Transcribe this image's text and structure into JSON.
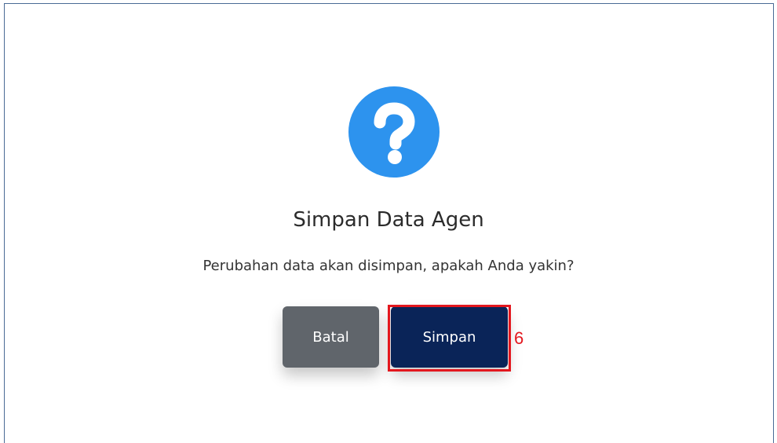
{
  "dialog": {
    "title": "Simpan Data Agen",
    "message": "Perubahan data akan disimpan, apakah Anda yakin?",
    "icon": "question-circle-icon",
    "cancel_label": "Batal",
    "confirm_label": "Simpan"
  },
  "annotation": {
    "step_number": "6"
  },
  "colors": {
    "icon_blue": "#2d93ee",
    "cancel_gray": "#60656b",
    "confirm_navy": "#0a2458",
    "highlight_red": "#e3171e"
  }
}
